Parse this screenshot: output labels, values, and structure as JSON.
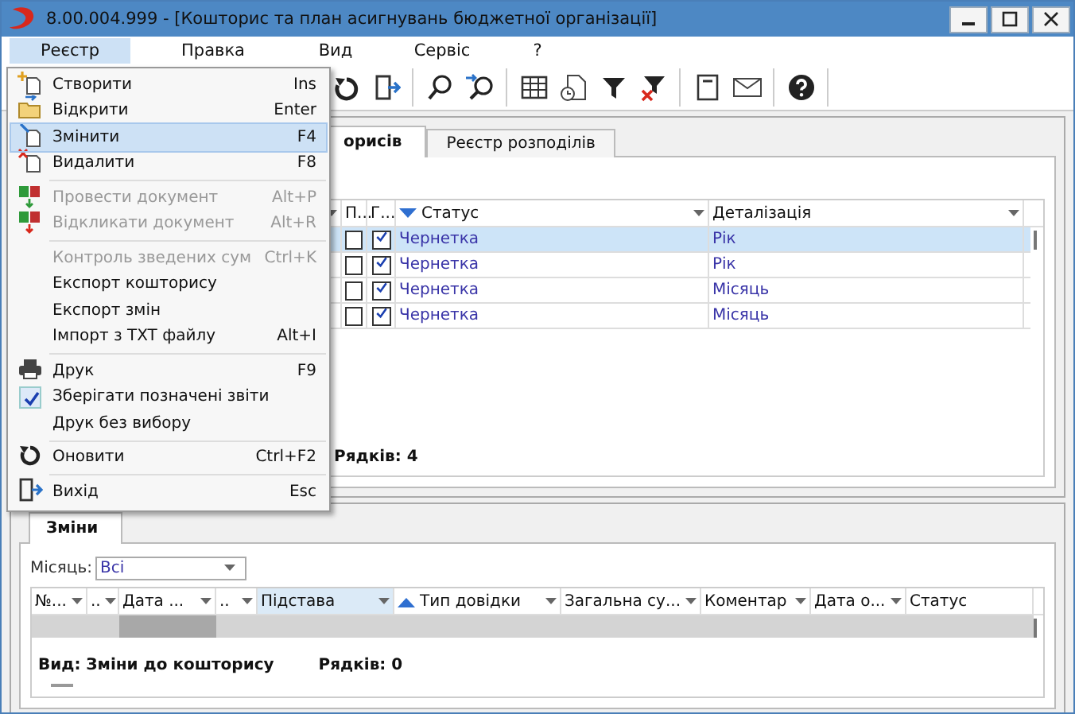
{
  "window": {
    "title": "8.00.004.999 - [Кошторис та план асигнувань бюджетної організації]"
  },
  "menu_bar": [
    {
      "label": "Реєстр",
      "selected": true
    },
    {
      "label": "Правка",
      "selected": false
    },
    {
      "label": "Вид",
      "selected": false
    },
    {
      "label": "Сервіс",
      "selected": false
    },
    {
      "label": "?",
      "selected": false
    }
  ],
  "menu": [
    {
      "kind": "item",
      "label": "Створити",
      "shortcut": "Ins",
      "disabled": false,
      "selected": false
    },
    {
      "kind": "item",
      "label": "Відкрити",
      "shortcut": "Enter",
      "disabled": false,
      "selected": false
    },
    {
      "kind": "item",
      "label": "Змінити",
      "shortcut": "F4",
      "disabled": false,
      "selected": true
    },
    {
      "kind": "item",
      "label": "Видалити",
      "shortcut": "F8",
      "disabled": false,
      "selected": false
    },
    {
      "kind": "separator"
    },
    {
      "kind": "item",
      "label": "Провести документ",
      "shortcut": "Alt+P",
      "disabled": true,
      "selected": false
    },
    {
      "kind": "item",
      "label": "Відкликати документ",
      "shortcut": "Alt+R",
      "disabled": true,
      "selected": false
    },
    {
      "kind": "separator"
    },
    {
      "kind": "item",
      "label": "Контроль зведених сум",
      "shortcut": "Ctrl+K",
      "disabled": true,
      "selected": false
    },
    {
      "kind": "item",
      "label": "Експорт кошторису",
      "disabled": false,
      "selected": false
    },
    {
      "kind": "item",
      "label": "Експорт змін",
      "disabled": false,
      "selected": false
    },
    {
      "kind": "item",
      "label": "Імпорт з TXT файлу",
      "shortcut": "Alt+I",
      "disabled": false,
      "selected": false
    },
    {
      "kind": "separator"
    },
    {
      "kind": "item",
      "label": "Друк",
      "shortcut": "F9",
      "disabled": false,
      "selected": false
    },
    {
      "kind": "check",
      "label": "Зберігати позначені звіти",
      "checked": true,
      "disabled": false,
      "selected": false
    },
    {
      "kind": "item",
      "label": "Друк без вибору",
      "disabled": false,
      "selected": false
    },
    {
      "kind": "separator"
    },
    {
      "kind": "item",
      "label": "Оновити",
      "shortcut": "Ctrl+F2",
      "disabled": false,
      "selected": false
    },
    {
      "kind": "separator"
    },
    {
      "kind": "item",
      "label": "Вихід",
      "shortcut": "Esc",
      "disabled": false,
      "selected": false
    }
  ],
  "upper": {
    "tabs": [
      {
        "label": "орисів",
        "selected": true
      },
      {
        "label": "Реєстр розподілів",
        "selected": false
      }
    ],
    "columns": [
      {
        "label": "П..."
      },
      {
        "label": "Г..."
      },
      {
        "label": "Статус",
        "sorted": true,
        "sort_ascending": false
      },
      {
        "label": "Деталізація"
      }
    ],
    "rows": [
      {
        "selected": true,
        "check_1": false,
        "check_2": true,
        "status": "Чернетка",
        "detail": "Рік"
      },
      {
        "selected": false,
        "check_1": false,
        "check_2": true,
        "status": "Чернетка",
        "detail": "Рік"
      },
      {
        "selected": false,
        "check_1": false,
        "check_2": true,
        "status": "Чернетка",
        "detail": "Місяць"
      },
      {
        "selected": false,
        "check_1": false,
        "check_2": true,
        "status": "Чернетка",
        "detail": "Місяць"
      }
    ],
    "row_count": "Рядків: 4"
  },
  "lower": {
    "tabs": [
      {
        "label": "Зміни",
        "selected": true
      }
    ],
    "filter": {
      "label": "Місяць:",
      "value": "Всі"
    },
    "columns": [
      {
        "label": "№...",
        "highlighted": false
      },
      {
        "label": "..",
        "highlighted": false
      },
      {
        "label": "Дата ...",
        "highlighted": false
      },
      {
        "label": "..",
        "highlighted": false
      },
      {
        "label": "Підстава",
        "highlighted": true
      },
      {
        "label": "Тип довідки",
        "highlighted": false,
        "sorted": true,
        "sort_ascending": true
      },
      {
        "label": "Загальна су...",
        "highlighted": false
      },
      {
        "label": "Коментар",
        "highlighted": false
      },
      {
        "label": "Дата о...",
        "highlighted": false
      },
      {
        "label": "Статус",
        "highlighted": false
      }
    ],
    "view": "Вид: Зміни до кошторису",
    "row_count": "Рядків: 0"
  }
}
